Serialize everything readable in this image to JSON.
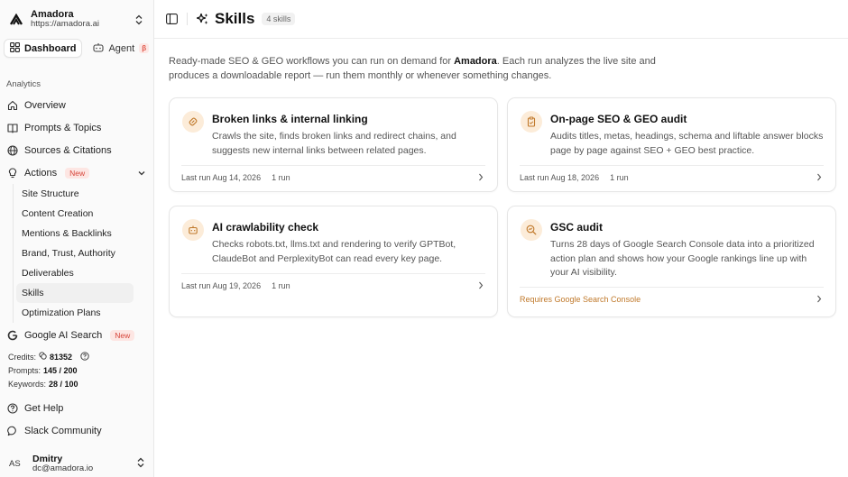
{
  "org": {
    "name": "Amadora",
    "url": "https://amadora.ai"
  },
  "topnav": {
    "dashboard": "Dashboard",
    "agent": "Agent",
    "agent_badge": "β"
  },
  "sidebar": {
    "section": "Analytics",
    "items": [
      {
        "label": "Overview",
        "icon": "home-icon"
      },
      {
        "label": "Prompts & Topics",
        "icon": "book-icon"
      },
      {
        "label": "Sources & Citations",
        "icon": "globe-icon"
      },
      {
        "label": "Actions",
        "icon": "lightbulb-icon",
        "badge": "New"
      }
    ],
    "actions_sub": [
      "Site Structure",
      "Content Creation",
      "Mentions & Backlinks",
      "Brand, Trust, Authority",
      "Deliverables",
      "Skills",
      "Optimization Plans"
    ],
    "google": {
      "label": "Google AI Search",
      "badge": "New"
    }
  },
  "credits": {
    "credits_label": "Credits:",
    "credits_value": "81352",
    "prompts_label": "Prompts:",
    "prompts_value": "145 / 200",
    "keywords_label": "Keywords:",
    "keywords_value": "28 / 100"
  },
  "bottom": {
    "help": "Get Help",
    "slack": "Slack Community"
  },
  "user": {
    "initials": "AS",
    "name": "Dmitry",
    "email": "dc@amadora.io"
  },
  "header": {
    "title": "Skills",
    "count": "4 skills"
  },
  "intro": {
    "before": "Ready-made SEO & GEO workflows you can run on demand for ",
    "brand": "Amadora",
    "after": ". Each run analyzes the live site and produces a downloadable report — run them monthly or whenever something changes."
  },
  "cards": [
    {
      "title": "Broken links & internal linking",
      "desc": "Crawls the site, finds broken links and redirect chains, and suggests new internal links between related pages.",
      "last_run": "Last run Aug 14, 2026",
      "runs": "1 run",
      "icon": "link-icon"
    },
    {
      "title": "On-page SEO & GEO audit",
      "desc": "Audits titles, metas, headings, schema and liftable answer blocks page by page against SEO + GEO best practice.",
      "last_run": "Last run Aug 18, 2026",
      "runs": "1 run",
      "icon": "clipboard-icon"
    },
    {
      "title": "AI crawlability check",
      "desc": "Checks robots.txt, llms.txt and rendering to verify GPTBot, ClaudeBot and PerplexityBot can read every key page.",
      "last_run": "Last run Aug 19, 2026",
      "runs": "1 run",
      "icon": "bot-icon"
    },
    {
      "title": "GSC audit",
      "desc": "Turns 28 days of Google Search Console data into a prioritized action plan and shows how your Google rankings line up with your AI visibility.",
      "requirement": "Requires Google Search Console",
      "icon": "search-chart-icon"
    }
  ],
  "colors": {
    "accent_orange": "#c0792b",
    "icon_bg": "#fcecd9",
    "new_badge": "#d6453a"
  }
}
